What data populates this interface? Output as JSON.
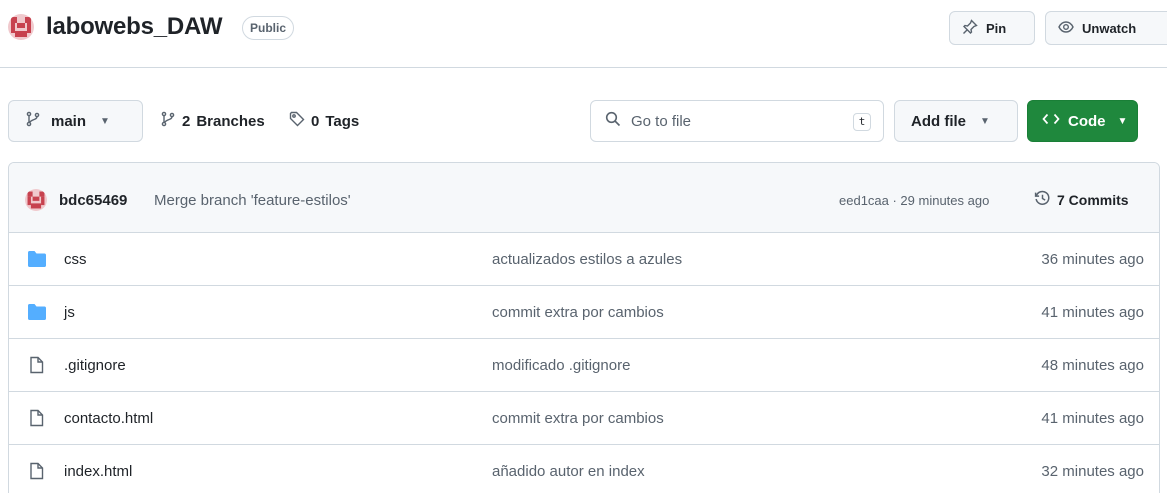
{
  "colors": {
    "accent_green": "#1f883d",
    "folder_blue": "#54aeff",
    "avatar_red": "#c7424f",
    "muted_text": "#59636e",
    "border": "#d1d9e0"
  },
  "header": {
    "repo_name": "labowebs_DAW",
    "visibility": "Public",
    "pin_label": "Pin",
    "unwatch_label": "Unwatch",
    "pin_icon": "pin-icon",
    "eye_icon": "eye-icon"
  },
  "toolbar": {
    "branch": "main",
    "branches_count": "2",
    "branches_label": "Branches",
    "tags_count": "0",
    "tags_label": "Tags",
    "search_placeholder": "Go to file",
    "search_shortcut": "t",
    "add_file_label": "Add file",
    "code_label": "Code"
  },
  "latest_commit": {
    "author": "bdc65469",
    "message": "Merge branch 'feature-estilos'",
    "meta": "eed1caa · 29 minutes ago",
    "commits_label": "7 Commits"
  },
  "files": [
    {
      "type": "folder",
      "name": "css",
      "commit": "actualizados estilos a azules",
      "time": "36 minutes ago"
    },
    {
      "type": "folder",
      "name": "js",
      "commit": "commit extra por cambios",
      "time": "41 minutes ago"
    },
    {
      "type": "file",
      "name": ".gitignore",
      "commit": "modificado .gitignore",
      "time": "48 minutes ago"
    },
    {
      "type": "file",
      "name": "contacto.html",
      "commit": "commit extra por cambios",
      "time": "41 minutes ago"
    },
    {
      "type": "file",
      "name": "index.html",
      "commit": "añadido autor en index",
      "time": "32 minutes ago"
    }
  ]
}
